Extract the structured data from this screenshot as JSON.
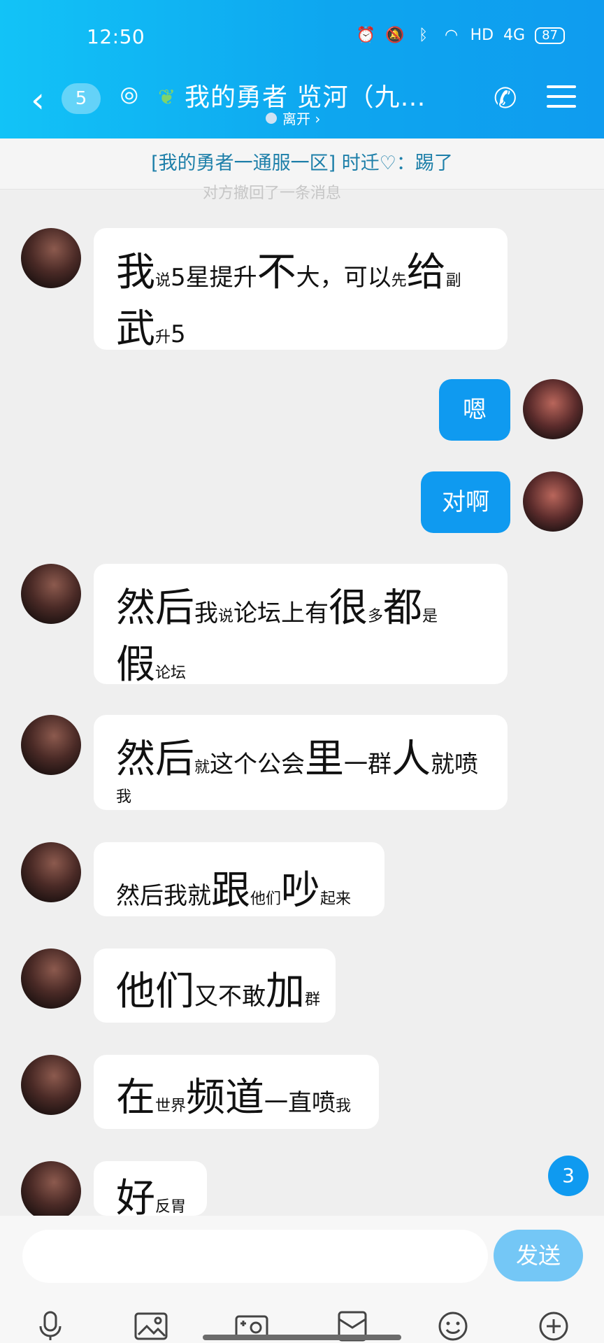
{
  "status_bar": {
    "time": "12:50",
    "network": "4G",
    "battery": "87",
    "hd": "HD"
  },
  "header": {
    "unread_count": "5",
    "title": "我的勇者 览河（九…",
    "presence": "离开 ›"
  },
  "notice": {
    "text": "[我的勇者一通服一区] 时迁♡：踢了",
    "faded_text": "对方撤回了一条消息"
  },
  "messages": [
    {
      "side": "left",
      "runs": [
        {
          "t": "我",
          "s": "big"
        },
        {
          "t": "说",
          "s": "sm"
        },
        {
          "t": "5星提升",
          "s": "med"
        },
        {
          "t": "不",
          "s": "big"
        },
        {
          "t": "大，可以",
          "s": "med"
        },
        {
          "t": "先",
          "s": "sm"
        },
        {
          "t": "给",
          "s": "big"
        },
        {
          "t": "副",
          "s": "sm"
        }
      ],
      "runs2": [
        {
          "t": "武",
          "s": "big"
        },
        {
          "t": "升",
          "s": "sm"
        },
        {
          "t": "5",
          "s": "med"
        }
      ]
    },
    {
      "side": "right",
      "text": "嗯"
    },
    {
      "side": "right",
      "text": "对啊"
    },
    {
      "side": "left",
      "runs": [
        {
          "t": "然后",
          "s": "big"
        },
        {
          "t": "我",
          "s": "med"
        },
        {
          "t": "说",
          "s": "sm"
        },
        {
          "t": "论坛上有",
          "s": "med"
        },
        {
          "t": "很",
          "s": "big"
        },
        {
          "t": "多",
          "s": "sm"
        },
        {
          "t": "都",
          "s": "big"
        },
        {
          "t": "是",
          "s": "sm"
        }
      ],
      "runs2": [
        {
          "t": "假",
          "s": "big"
        },
        {
          "t": "论坛",
          "s": "sm"
        }
      ]
    },
    {
      "side": "left",
      "runs": [
        {
          "t": "然后",
          "s": "big"
        },
        {
          "t": "就",
          "s": "sm"
        },
        {
          "t": "这个公会",
          "s": "med"
        },
        {
          "t": "里",
          "s": "big"
        },
        {
          "t": "一群",
          "s": "med"
        },
        {
          "t": "人",
          "s": "big"
        },
        {
          "t": "就喷",
          "s": "med"
        }
      ],
      "runs2": [
        {
          "t": "我",
          "s": "sm"
        }
      ]
    },
    {
      "side": "left",
      "runs": [
        {
          "t": "然后我就",
          "s": "med"
        },
        {
          "t": "跟",
          "s": "big"
        },
        {
          "t": "他们",
          "s": "sm"
        },
        {
          "t": "吵",
          "s": "big"
        },
        {
          "t": "起来",
          "s": "sm"
        }
      ]
    },
    {
      "side": "left",
      "runs": [
        {
          "t": "他们",
          "s": "big"
        },
        {
          "t": "又不敢",
          "s": "med"
        },
        {
          "t": "加",
          "s": "big"
        },
        {
          "t": "群",
          "s": "sm"
        }
      ]
    },
    {
      "side": "left",
      "runs": [
        {
          "t": "在",
          "s": "big"
        },
        {
          "t": "世界",
          "s": "sm"
        },
        {
          "t": "频道",
          "s": "big"
        },
        {
          "t": "一直喷",
          "s": "med"
        },
        {
          "t": "我",
          "s": "sm"
        }
      ]
    },
    {
      "side": "left",
      "runs": [
        {
          "t": "好",
          "s": "big"
        },
        {
          "t": "反胃",
          "s": "sm"
        }
      ]
    }
  ],
  "new_message_badge": "3",
  "input": {
    "placeholder": "",
    "send_label": "发送"
  },
  "toolbar_icons": [
    "microphone-icon",
    "image-icon",
    "camera-icon",
    "red-packet-icon",
    "emoji-icon",
    "plus-icon"
  ]
}
